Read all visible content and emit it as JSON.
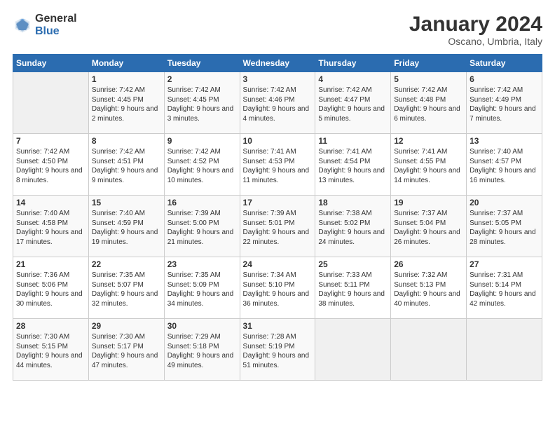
{
  "logo": {
    "general": "General",
    "blue": "Blue"
  },
  "header": {
    "title": "January 2024",
    "subtitle": "Oscano, Umbria, Italy"
  },
  "weekdays": [
    "Sunday",
    "Monday",
    "Tuesday",
    "Wednesday",
    "Thursday",
    "Friday",
    "Saturday"
  ],
  "weeks": [
    [
      {
        "day": "",
        "sunrise": "",
        "sunset": "",
        "daylight": ""
      },
      {
        "day": "1",
        "sunrise": "Sunrise: 7:42 AM",
        "sunset": "Sunset: 4:45 PM",
        "daylight": "Daylight: 9 hours and 2 minutes."
      },
      {
        "day": "2",
        "sunrise": "Sunrise: 7:42 AM",
        "sunset": "Sunset: 4:45 PM",
        "daylight": "Daylight: 9 hours and 3 minutes."
      },
      {
        "day": "3",
        "sunrise": "Sunrise: 7:42 AM",
        "sunset": "Sunset: 4:46 PM",
        "daylight": "Daylight: 9 hours and 4 minutes."
      },
      {
        "day": "4",
        "sunrise": "Sunrise: 7:42 AM",
        "sunset": "Sunset: 4:47 PM",
        "daylight": "Daylight: 9 hours and 5 minutes."
      },
      {
        "day": "5",
        "sunrise": "Sunrise: 7:42 AM",
        "sunset": "Sunset: 4:48 PM",
        "daylight": "Daylight: 9 hours and 6 minutes."
      },
      {
        "day": "6",
        "sunrise": "Sunrise: 7:42 AM",
        "sunset": "Sunset: 4:49 PM",
        "daylight": "Daylight: 9 hours and 7 minutes."
      }
    ],
    [
      {
        "day": "7",
        "sunrise": "Sunrise: 7:42 AM",
        "sunset": "Sunset: 4:50 PM",
        "daylight": "Daylight: 9 hours and 8 minutes."
      },
      {
        "day": "8",
        "sunrise": "Sunrise: 7:42 AM",
        "sunset": "Sunset: 4:51 PM",
        "daylight": "Daylight: 9 hours and 9 minutes."
      },
      {
        "day": "9",
        "sunrise": "Sunrise: 7:42 AM",
        "sunset": "Sunset: 4:52 PM",
        "daylight": "Daylight: 9 hours and 10 minutes."
      },
      {
        "day": "10",
        "sunrise": "Sunrise: 7:41 AM",
        "sunset": "Sunset: 4:53 PM",
        "daylight": "Daylight: 9 hours and 11 minutes."
      },
      {
        "day": "11",
        "sunrise": "Sunrise: 7:41 AM",
        "sunset": "Sunset: 4:54 PM",
        "daylight": "Daylight: 9 hours and 13 minutes."
      },
      {
        "day": "12",
        "sunrise": "Sunrise: 7:41 AM",
        "sunset": "Sunset: 4:55 PM",
        "daylight": "Daylight: 9 hours and 14 minutes."
      },
      {
        "day": "13",
        "sunrise": "Sunrise: 7:40 AM",
        "sunset": "Sunset: 4:57 PM",
        "daylight": "Daylight: 9 hours and 16 minutes."
      }
    ],
    [
      {
        "day": "14",
        "sunrise": "Sunrise: 7:40 AM",
        "sunset": "Sunset: 4:58 PM",
        "daylight": "Daylight: 9 hours and 17 minutes."
      },
      {
        "day": "15",
        "sunrise": "Sunrise: 7:40 AM",
        "sunset": "Sunset: 4:59 PM",
        "daylight": "Daylight: 9 hours and 19 minutes."
      },
      {
        "day": "16",
        "sunrise": "Sunrise: 7:39 AM",
        "sunset": "Sunset: 5:00 PM",
        "daylight": "Daylight: 9 hours and 21 minutes."
      },
      {
        "day": "17",
        "sunrise": "Sunrise: 7:39 AM",
        "sunset": "Sunset: 5:01 PM",
        "daylight": "Daylight: 9 hours and 22 minutes."
      },
      {
        "day": "18",
        "sunrise": "Sunrise: 7:38 AM",
        "sunset": "Sunset: 5:02 PM",
        "daylight": "Daylight: 9 hours and 24 minutes."
      },
      {
        "day": "19",
        "sunrise": "Sunrise: 7:37 AM",
        "sunset": "Sunset: 5:04 PM",
        "daylight": "Daylight: 9 hours and 26 minutes."
      },
      {
        "day": "20",
        "sunrise": "Sunrise: 7:37 AM",
        "sunset": "Sunset: 5:05 PM",
        "daylight": "Daylight: 9 hours and 28 minutes."
      }
    ],
    [
      {
        "day": "21",
        "sunrise": "Sunrise: 7:36 AM",
        "sunset": "Sunset: 5:06 PM",
        "daylight": "Daylight: 9 hours and 30 minutes."
      },
      {
        "day": "22",
        "sunrise": "Sunrise: 7:35 AM",
        "sunset": "Sunset: 5:07 PM",
        "daylight": "Daylight: 9 hours and 32 minutes."
      },
      {
        "day": "23",
        "sunrise": "Sunrise: 7:35 AM",
        "sunset": "Sunset: 5:09 PM",
        "daylight": "Daylight: 9 hours and 34 minutes."
      },
      {
        "day": "24",
        "sunrise": "Sunrise: 7:34 AM",
        "sunset": "Sunset: 5:10 PM",
        "daylight": "Daylight: 9 hours and 36 minutes."
      },
      {
        "day": "25",
        "sunrise": "Sunrise: 7:33 AM",
        "sunset": "Sunset: 5:11 PM",
        "daylight": "Daylight: 9 hours and 38 minutes."
      },
      {
        "day": "26",
        "sunrise": "Sunrise: 7:32 AM",
        "sunset": "Sunset: 5:13 PM",
        "daylight": "Daylight: 9 hours and 40 minutes."
      },
      {
        "day": "27",
        "sunrise": "Sunrise: 7:31 AM",
        "sunset": "Sunset: 5:14 PM",
        "daylight": "Daylight: 9 hours and 42 minutes."
      }
    ],
    [
      {
        "day": "28",
        "sunrise": "Sunrise: 7:30 AM",
        "sunset": "Sunset: 5:15 PM",
        "daylight": "Daylight: 9 hours and 44 minutes."
      },
      {
        "day": "29",
        "sunrise": "Sunrise: 7:30 AM",
        "sunset": "Sunset: 5:17 PM",
        "daylight": "Daylight: 9 hours and 47 minutes."
      },
      {
        "day": "30",
        "sunrise": "Sunrise: 7:29 AM",
        "sunset": "Sunset: 5:18 PM",
        "daylight": "Daylight: 9 hours and 49 minutes."
      },
      {
        "day": "31",
        "sunrise": "Sunrise: 7:28 AM",
        "sunset": "Sunset: 5:19 PM",
        "daylight": "Daylight: 9 hours and 51 minutes."
      },
      {
        "day": "",
        "sunrise": "",
        "sunset": "",
        "daylight": ""
      },
      {
        "day": "",
        "sunrise": "",
        "sunset": "",
        "daylight": ""
      },
      {
        "day": "",
        "sunrise": "",
        "sunset": "",
        "daylight": ""
      }
    ]
  ]
}
